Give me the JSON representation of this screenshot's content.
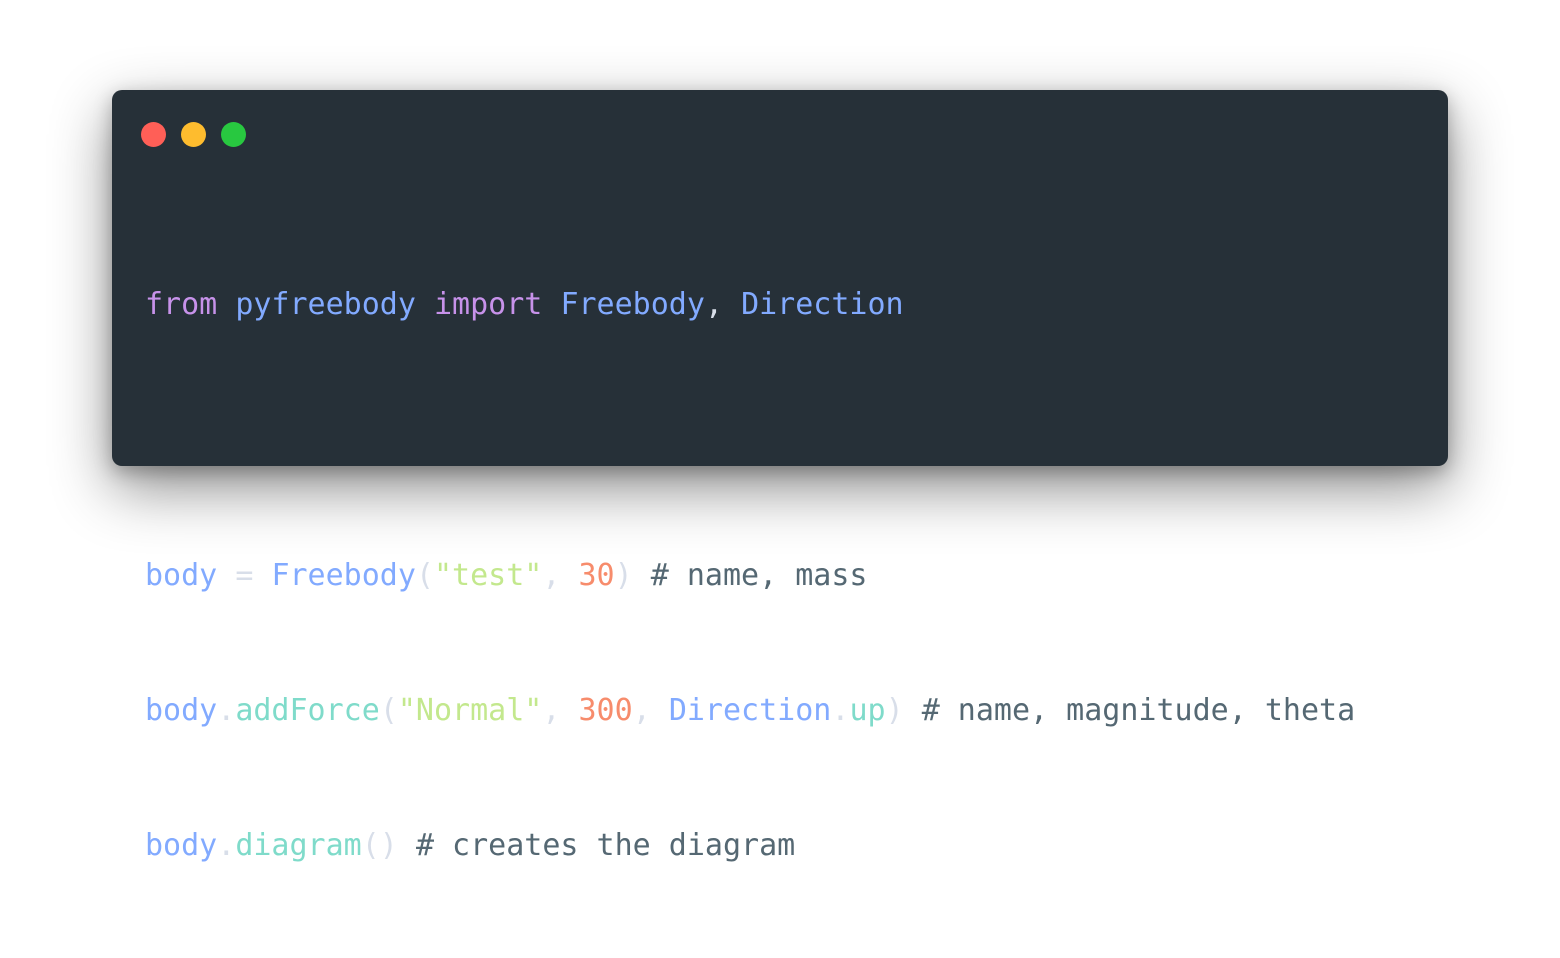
{
  "window": {
    "controls": [
      {
        "name": "close",
        "color": "#ff5f57"
      },
      {
        "name": "minimize",
        "color": "#febc2e"
      },
      {
        "name": "zoom",
        "color": "#28c840"
      }
    ]
  },
  "code": {
    "line1": {
      "from": "from",
      "module": "pyfreebody",
      "import": "import",
      "name1": "Freebody",
      "comma": ",",
      "name2": "Direction"
    },
    "line3": {
      "var": "body",
      "eq": "=",
      "cls": "Freebody",
      "open": "(",
      "arg1": "\"test\"",
      "comma": ",",
      "arg2": "30",
      "close": ")",
      "comment": "# name, mass"
    },
    "line4": {
      "var": "body",
      "dot": ".",
      "method": "addForce",
      "open": "(",
      "arg1": "\"Normal\"",
      "comma1": ",",
      "arg2": "300",
      "comma2": ",",
      "obj": "Direction",
      "dot2": ".",
      "attr": "up",
      "close": ")",
      "comment": "# name, magnitude, theta"
    },
    "line5": {
      "var": "body",
      "dot": ".",
      "method": "diagram",
      "parens": "()",
      "comment": "# creates the diagram"
    }
  }
}
